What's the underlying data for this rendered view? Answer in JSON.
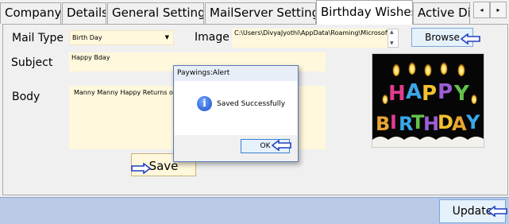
{
  "tabs": [
    {
      "label": "Company"
    },
    {
      "label": "Details"
    },
    {
      "label": "General Settings"
    },
    {
      "label": "MailServer Settings"
    },
    {
      "label": "Birthday Wishes",
      "active": true
    },
    {
      "label": "Active Di"
    }
  ],
  "tab_scroll": {
    "left": "◂",
    "right": "▸"
  },
  "form": {
    "mail_type_label": "Mail Type",
    "mail_type_value": "Birth Day",
    "image_label": "Image",
    "image_path": "C:\\Users\\DivyaJyothi\\AppData\\Roaming\\Microsoft\\Windows\\Start",
    "browse_label": "Browse",
    "subject_label": "Subject",
    "subject_value": "Happy Bday",
    "body_label": "Body",
    "body_value": "Manny Manny Happy Returns of",
    "save_label": "Save"
  },
  "image_letters": {
    "row1": [
      "H",
      "A",
      "P",
      "P",
      "Y"
    ],
    "row2": [
      "B",
      "I",
      "R",
      "T",
      "H",
      "D",
      "A",
      "Y"
    ]
  },
  "bottom": {
    "update_label": "Update"
  },
  "dialog": {
    "title": "Paywings:Alert",
    "message": "Saved Successfully",
    "ok_label": "OK",
    "icon": "information-icon"
  },
  "colors": {
    "field_background": "#fff8dc",
    "bottom_bar": "#b9c9e6",
    "button_face": "#e5f1fb",
    "button_border": "#7aa7d9",
    "arrow_outline": "#1f3fc4"
  }
}
